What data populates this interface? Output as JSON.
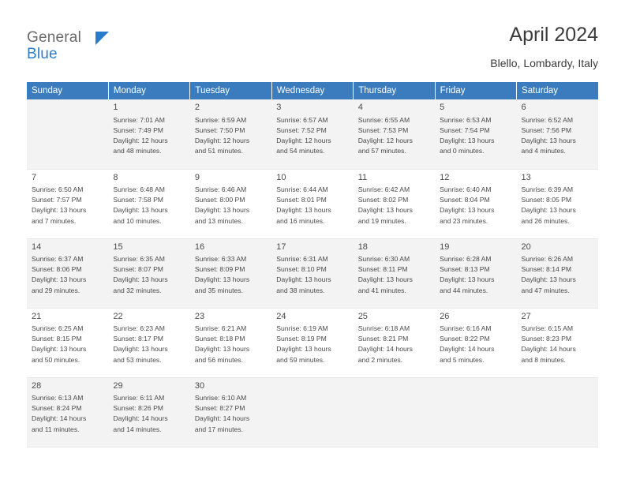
{
  "brand": {
    "name_part1": "General",
    "name_part2": "Blue",
    "accent_color": "#2b7cc9"
  },
  "header": {
    "title": "April 2024",
    "location": "Blello, Lombardy, Italy"
  },
  "calendar": {
    "header_bg": "#3a7cbe",
    "weekdays": [
      "Sunday",
      "Monday",
      "Tuesday",
      "Wednesday",
      "Thursday",
      "Friday",
      "Saturday"
    ],
    "weeks": [
      [
        {
          "day": "",
          "detail": ""
        },
        {
          "day": "1",
          "detail": "Sunrise: 7:01 AM\nSunset: 7:49 PM\nDaylight: 12 hours\nand 48 minutes."
        },
        {
          "day": "2",
          "detail": "Sunrise: 6:59 AM\nSunset: 7:50 PM\nDaylight: 12 hours\nand 51 minutes."
        },
        {
          "day": "3",
          "detail": "Sunrise: 6:57 AM\nSunset: 7:52 PM\nDaylight: 12 hours\nand 54 minutes."
        },
        {
          "day": "4",
          "detail": "Sunrise: 6:55 AM\nSunset: 7:53 PM\nDaylight: 12 hours\nand 57 minutes."
        },
        {
          "day": "5",
          "detail": "Sunrise: 6:53 AM\nSunset: 7:54 PM\nDaylight: 13 hours\nand 0 minutes."
        },
        {
          "day": "6",
          "detail": "Sunrise: 6:52 AM\nSunset: 7:56 PM\nDaylight: 13 hours\nand 4 minutes."
        }
      ],
      [
        {
          "day": "7",
          "detail": "Sunrise: 6:50 AM\nSunset: 7:57 PM\nDaylight: 13 hours\nand 7 minutes."
        },
        {
          "day": "8",
          "detail": "Sunrise: 6:48 AM\nSunset: 7:58 PM\nDaylight: 13 hours\nand 10 minutes."
        },
        {
          "day": "9",
          "detail": "Sunrise: 6:46 AM\nSunset: 8:00 PM\nDaylight: 13 hours\nand 13 minutes."
        },
        {
          "day": "10",
          "detail": "Sunrise: 6:44 AM\nSunset: 8:01 PM\nDaylight: 13 hours\nand 16 minutes."
        },
        {
          "day": "11",
          "detail": "Sunrise: 6:42 AM\nSunset: 8:02 PM\nDaylight: 13 hours\nand 19 minutes."
        },
        {
          "day": "12",
          "detail": "Sunrise: 6:40 AM\nSunset: 8:04 PM\nDaylight: 13 hours\nand 23 minutes."
        },
        {
          "day": "13",
          "detail": "Sunrise: 6:39 AM\nSunset: 8:05 PM\nDaylight: 13 hours\nand 26 minutes."
        }
      ],
      [
        {
          "day": "14",
          "detail": "Sunrise: 6:37 AM\nSunset: 8:06 PM\nDaylight: 13 hours\nand 29 minutes."
        },
        {
          "day": "15",
          "detail": "Sunrise: 6:35 AM\nSunset: 8:07 PM\nDaylight: 13 hours\nand 32 minutes."
        },
        {
          "day": "16",
          "detail": "Sunrise: 6:33 AM\nSunset: 8:09 PM\nDaylight: 13 hours\nand 35 minutes."
        },
        {
          "day": "17",
          "detail": "Sunrise: 6:31 AM\nSunset: 8:10 PM\nDaylight: 13 hours\nand 38 minutes."
        },
        {
          "day": "18",
          "detail": "Sunrise: 6:30 AM\nSunset: 8:11 PM\nDaylight: 13 hours\nand 41 minutes."
        },
        {
          "day": "19",
          "detail": "Sunrise: 6:28 AM\nSunset: 8:13 PM\nDaylight: 13 hours\nand 44 minutes."
        },
        {
          "day": "20",
          "detail": "Sunrise: 6:26 AM\nSunset: 8:14 PM\nDaylight: 13 hours\nand 47 minutes."
        }
      ],
      [
        {
          "day": "21",
          "detail": "Sunrise: 6:25 AM\nSunset: 8:15 PM\nDaylight: 13 hours\nand 50 minutes."
        },
        {
          "day": "22",
          "detail": "Sunrise: 6:23 AM\nSunset: 8:17 PM\nDaylight: 13 hours\nand 53 minutes."
        },
        {
          "day": "23",
          "detail": "Sunrise: 6:21 AM\nSunset: 8:18 PM\nDaylight: 13 hours\nand 56 minutes."
        },
        {
          "day": "24",
          "detail": "Sunrise: 6:19 AM\nSunset: 8:19 PM\nDaylight: 13 hours\nand 59 minutes."
        },
        {
          "day": "25",
          "detail": "Sunrise: 6:18 AM\nSunset: 8:21 PM\nDaylight: 14 hours\nand 2 minutes."
        },
        {
          "day": "26",
          "detail": "Sunrise: 6:16 AM\nSunset: 8:22 PM\nDaylight: 14 hours\nand 5 minutes."
        },
        {
          "day": "27",
          "detail": "Sunrise: 6:15 AM\nSunset: 8:23 PM\nDaylight: 14 hours\nand 8 minutes."
        }
      ],
      [
        {
          "day": "28",
          "detail": "Sunrise: 6:13 AM\nSunset: 8:24 PM\nDaylight: 14 hours\nand 11 minutes."
        },
        {
          "day": "29",
          "detail": "Sunrise: 6:11 AM\nSunset: 8:26 PM\nDaylight: 14 hours\nand 14 minutes."
        },
        {
          "day": "30",
          "detail": "Sunrise: 6:10 AM\nSunset: 8:27 PM\nDaylight: 14 hours\nand 17 minutes."
        },
        {
          "day": "",
          "detail": ""
        },
        {
          "day": "",
          "detail": ""
        },
        {
          "day": "",
          "detail": ""
        },
        {
          "day": "",
          "detail": ""
        }
      ]
    ]
  }
}
